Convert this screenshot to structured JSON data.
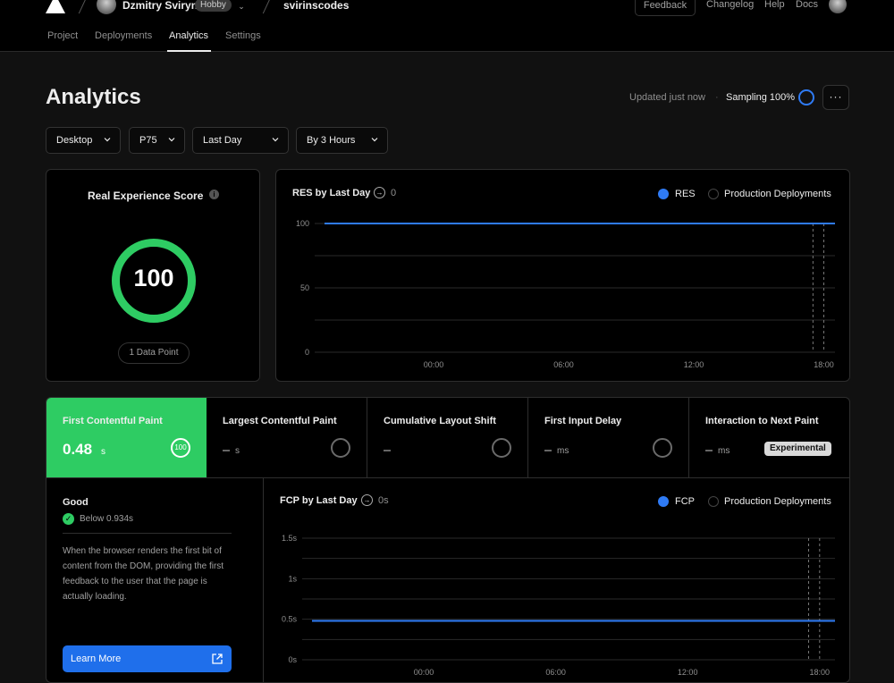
{
  "nav": {
    "user_name": "Dzmitry Sviryn",
    "plan_badge": "Hobby",
    "project_name": "svirinscodes",
    "feedback_label": "Feedback",
    "links": [
      "Changelog",
      "Help",
      "Docs"
    ]
  },
  "tabs": [
    "Project",
    "Deployments",
    "Analytics",
    "Settings"
  ],
  "active_tab": "Analytics",
  "page": {
    "title": "Analytics",
    "updated": "Updated just now",
    "separator": "·",
    "sampling": "Sampling 100%",
    "more_label": "···"
  },
  "filters": [
    {
      "label": "Desktop"
    },
    {
      "label": "P75"
    },
    {
      "label": "Last Day"
    },
    {
      "label": "By 3 Hours"
    }
  ],
  "score_card": {
    "title": "Real Experience Score",
    "info_icon": "i",
    "score": "100",
    "data_points": "1 Data Point"
  },
  "res_chart": {
    "title": "RES by Last Day",
    "count": "0",
    "legend_primary": "RES",
    "legend_secondary": "Production Deployments"
  },
  "metrics": [
    {
      "name": "First Contentful Paint",
      "value": "0.48",
      "unit": "s",
      "score": "100",
      "active": true
    },
    {
      "name": "Largest Contentful Paint",
      "unit": "s"
    },
    {
      "name": "Cumulative Layout Shift",
      "unit": ""
    },
    {
      "name": "First Input Delay",
      "unit": "ms"
    },
    {
      "name": "Interaction to Next Paint",
      "unit": "ms",
      "badge": "Experimental"
    }
  ],
  "detail": {
    "status": "Good",
    "threshold": "Below 0.934s",
    "description": "When the browser renders the first bit of content from the DOM, providing the first feedback to the user that the page is actually loading.",
    "learn_more": "Learn More"
  },
  "fcp_chart": {
    "title": "FCP by Last Day",
    "count": "0s",
    "legend_primary": "FCP",
    "legend_secondary": "Production Deployments"
  },
  "colors": {
    "accent_blue": "#2f7bf5",
    "good_green": "#2ecc63",
    "active_tab_bg": "#2ecc63"
  },
  "chart_data": [
    {
      "type": "line",
      "title": "RES by Last Day",
      "x_ticks": [
        "00:00",
        "06:00",
        "12:00",
        "18:00"
      ],
      "y_ticks": [
        "100",
        "50",
        "0"
      ],
      "ylim": [
        0,
        100
      ],
      "series": [
        {
          "name": "RES",
          "y": 100
        }
      ],
      "deployments": [
        "17:30",
        "18:00"
      ],
      "legend": "top-right",
      "grid": true
    },
    {
      "type": "line",
      "title": "FCP by Last Day",
      "x_ticks": [
        "00:00",
        "06:00",
        "12:00",
        "18:00"
      ],
      "y_ticks": [
        "1.5s",
        "1s",
        "0.5s",
        "0s"
      ],
      "ylim": [
        0,
        1.5
      ],
      "series": [
        {
          "name": "FCP",
          "y": 0.48
        }
      ],
      "deployments": [
        "17:30",
        "18:00"
      ],
      "legend": "top-right",
      "grid": true
    }
  ]
}
